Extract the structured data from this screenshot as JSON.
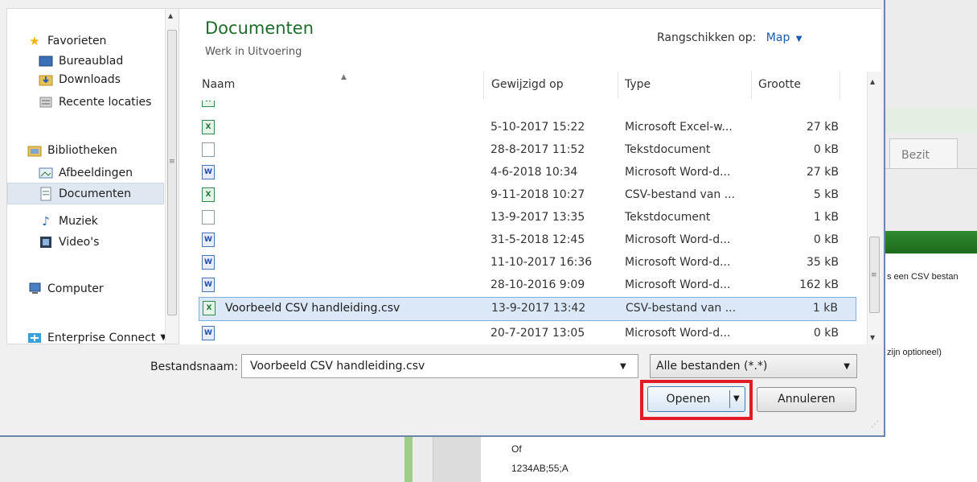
{
  "background": {
    "tab_label": "Bezit",
    "snippet_1": "s een CSV bestan",
    "snippet_2": "zijn optioneel)",
    "bottom_line_1": "Of",
    "bottom_line_2": "1234AB;55;A"
  },
  "nav": {
    "items": [
      {
        "label": "Favorieten",
        "icon": "star-icon"
      },
      {
        "label": "Bureaublad",
        "icon": "desktop-icon"
      },
      {
        "label": "Downloads",
        "icon": "downloads-folder-icon"
      },
      {
        "label": "Recente locaties",
        "icon": "recent-locations-icon"
      },
      {
        "label": "Bibliotheken",
        "icon": "libraries-icon"
      },
      {
        "label": "Afbeeldingen",
        "icon": "pictures-icon"
      },
      {
        "label": "Documenten",
        "icon": "documents-icon"
      },
      {
        "label": "Muziek",
        "icon": "music-icon"
      },
      {
        "label": "Video's",
        "icon": "video-icon"
      },
      {
        "label": "Computer",
        "icon": "computer-icon"
      },
      {
        "label": "Enterprise Connect",
        "icon": "network-icon"
      }
    ]
  },
  "library": {
    "title": "Documenten",
    "subtitle": "Werk in Uitvoering",
    "arrange_label": "Rangschikken op:",
    "arrange_value": "Map"
  },
  "columns": {
    "name": "Naam",
    "modified": "Gewijzigd op",
    "type": "Type",
    "size": "Grootte"
  },
  "rows": [
    {
      "name": "",
      "date": "5-10-2017 15:22",
      "type": "Microsoft Excel-w...",
      "size": "27 kB",
      "icon": "excel-file-icon"
    },
    {
      "name": "",
      "date": "28-8-2017 11:52",
      "type": "Tekstdocument",
      "size": "0 kB",
      "icon": "text-file-icon"
    },
    {
      "name": "",
      "date": "4-6-2018 10:34",
      "type": "Microsoft Word-d...",
      "size": "27 kB",
      "icon": "word-file-icon"
    },
    {
      "name": "",
      "date": "9-11-2018 10:27",
      "type": "CSV-bestand van ...",
      "size": "5 kB",
      "icon": "csv-file-icon"
    },
    {
      "name": "",
      "date": "13-9-2017 13:35",
      "type": "Tekstdocument",
      "size": "1 kB",
      "icon": "text-file-icon"
    },
    {
      "name": "",
      "date": "31-5-2018 12:45",
      "type": "Microsoft Word-d...",
      "size": "0 kB",
      "icon": "word-file-icon"
    },
    {
      "name": "",
      "date": "11-10-2017 16:36",
      "type": "Microsoft Word-d...",
      "size": "35 kB",
      "icon": "word-file-icon"
    },
    {
      "name": "",
      "date": "28-10-2016 9:09",
      "type": "Microsoft Word-d...",
      "size": "162 kB",
      "icon": "word-file-icon"
    },
    {
      "name": "Voorbeeld CSV handleiding.csv",
      "date": "13-9-2017 13:42",
      "type": "CSV-bestand van ...",
      "size": "1 kB",
      "icon": "csv-file-icon",
      "selected": true
    },
    {
      "name": "",
      "date": "20-7-2017 13:05",
      "type": "Microsoft Word-d...",
      "size": "0 kB",
      "icon": "word-file-icon"
    }
  ],
  "footer": {
    "filename_label": "Bestandsnaam:",
    "filename_value": "Voorbeeld CSV handleiding.csv",
    "filter_value": "Alle bestanden (*.*)",
    "open_label": "Openen",
    "cancel_label": "Annuleren"
  },
  "colors": {
    "title_green": "#1e6b2c",
    "highlight_red": "#e01b24",
    "selection_blue": "#dbe8f7"
  }
}
